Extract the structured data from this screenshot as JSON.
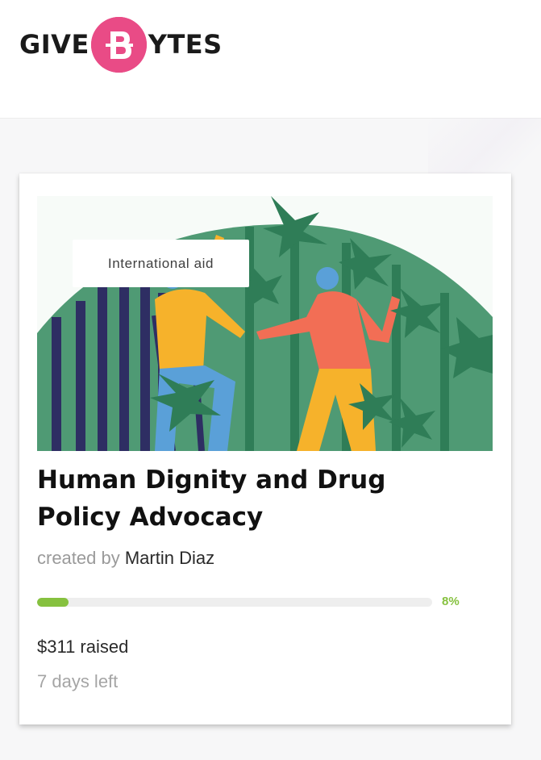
{
  "header": {
    "logo": {
      "prefix": "GIVE",
      "suffix": "YTES",
      "mark_color": "#e94b86"
    }
  },
  "campaign": {
    "category": "International aid",
    "title": "Human Dignity and Drug Policy Advocacy",
    "created_by_label": "created by",
    "creator_name": "Martin Diaz",
    "progress_percent": 8,
    "progress_label": "8%",
    "raised_text": "$311 raised",
    "days_left_text": "7 days left",
    "accent_color": "#86c13f"
  }
}
